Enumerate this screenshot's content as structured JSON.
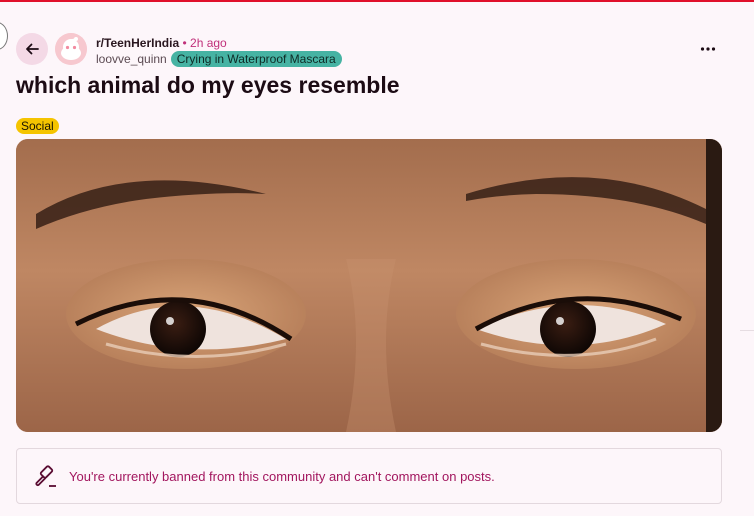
{
  "post": {
    "community": "r/TeenHerIndia",
    "time": "2h ago",
    "username": "loovve_quinn",
    "user_flair": "Crying in Waterproof Mascara",
    "title": "which animal do my eyes resemble",
    "post_flair": "Social",
    "image_description": "photo",
    "banned_notice": "You're currently banned from this community and can't comment on posts."
  },
  "icons": {
    "back": "arrow-left-icon",
    "avatar": "snoo-avatar",
    "more": "more-horizontal-icon",
    "banned": "gavel-icon"
  },
  "colors": {
    "background": "#fdf6fa",
    "accent_time": "#c0307a",
    "user_flair_bg": "#46b3a3",
    "post_flair_bg": "#f5c400",
    "banned_text": "#a2165e",
    "top_rule": "#e0102a"
  }
}
